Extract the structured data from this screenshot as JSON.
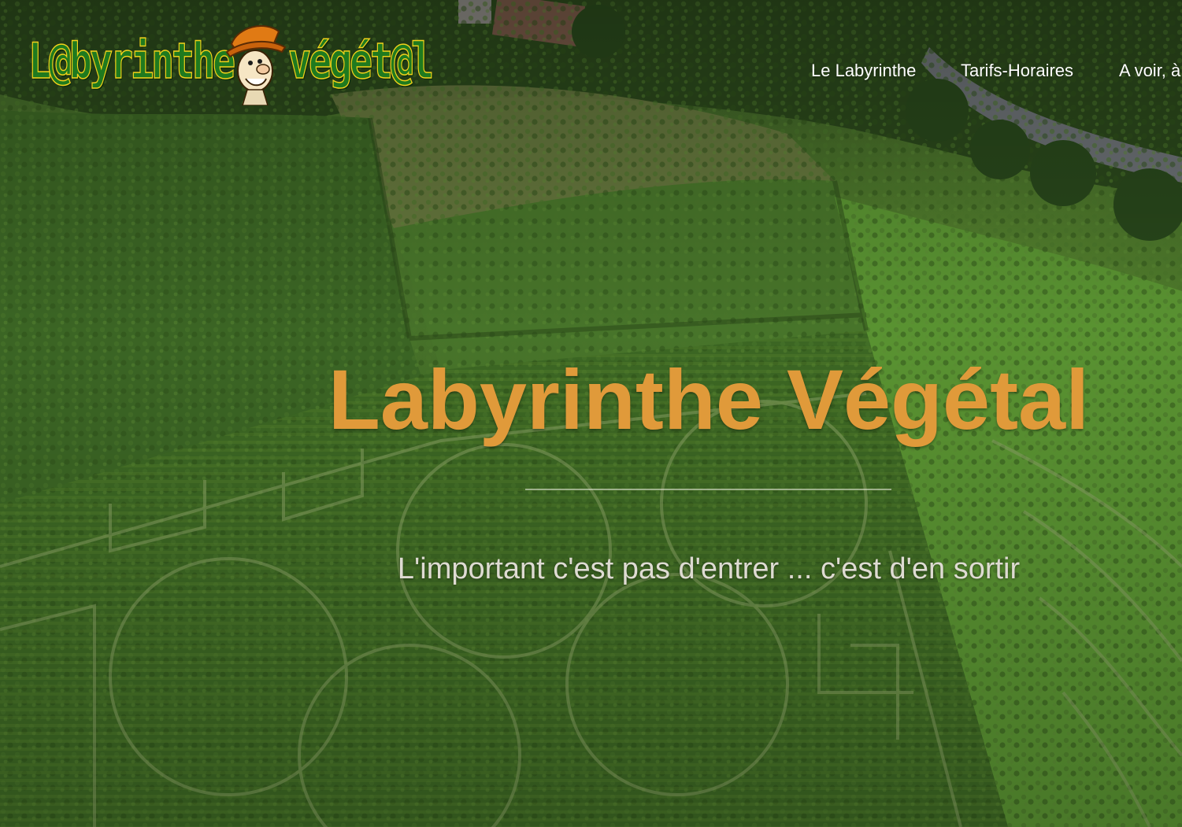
{
  "header": {
    "logo": {
      "text_left": "L@byrinthe",
      "text_right": "végét@l",
      "mascot_icon": "cartoon-explorer-mascot-icon"
    },
    "nav": [
      {
        "label": "Le Labyrinthe"
      },
      {
        "label": "Tarifs-Horaires"
      },
      {
        "label": "A voir, à"
      }
    ]
  },
  "hero": {
    "background": "aerial-photo-of-hedge-maze",
    "title": "Labyrinthe Végétal",
    "subtitle": "L'important c'est pas d'entrer ... c'est d'en sortir"
  },
  "colors": {
    "title": "#e09a3a",
    "nav_text": "#ffffff",
    "subtitle": "#dedbd2",
    "logo_green": "#1f7a1f",
    "logo_outline": "#f2d21a"
  }
}
